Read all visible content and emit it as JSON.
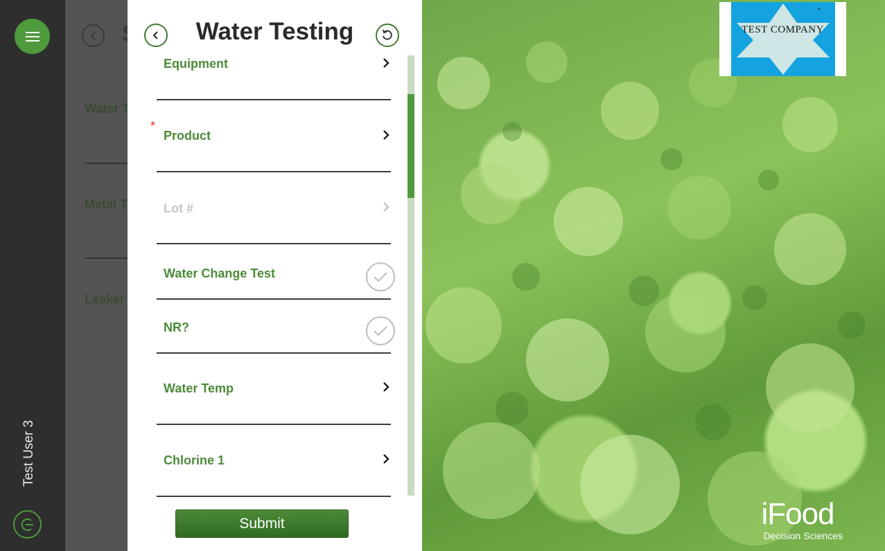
{
  "nav": {
    "user_name": "Test User 3",
    "accent_color": "#4f9a3d"
  },
  "background_form": {
    "title": "S",
    "labels": [
      "Water T",
      "Metal T",
      "Leaker"
    ]
  },
  "form": {
    "title": "Water Testing",
    "fields": [
      {
        "label": "Equipment",
        "type": "select",
        "required": false,
        "enabled": true
      },
      {
        "label": "Product",
        "type": "select",
        "required": true,
        "enabled": true
      },
      {
        "label": "Lot #",
        "type": "select",
        "required": false,
        "enabled": false
      },
      {
        "label": "Water Change Test",
        "type": "checkbox",
        "required": false,
        "enabled": true
      },
      {
        "label": "NR?",
        "type": "checkbox",
        "required": false,
        "enabled": true
      },
      {
        "label": "Water Temp",
        "type": "select",
        "required": false,
        "enabled": true
      },
      {
        "label": "Chlorine 1",
        "type": "select",
        "required": false,
        "enabled": true
      }
    ],
    "required_marker": "*",
    "submit_label": "Submit"
  },
  "branding": {
    "company_logo_text": "TEST COMPANY",
    "app_logo_name": "iFood",
    "app_logo_sub": "Decision Sciences"
  }
}
